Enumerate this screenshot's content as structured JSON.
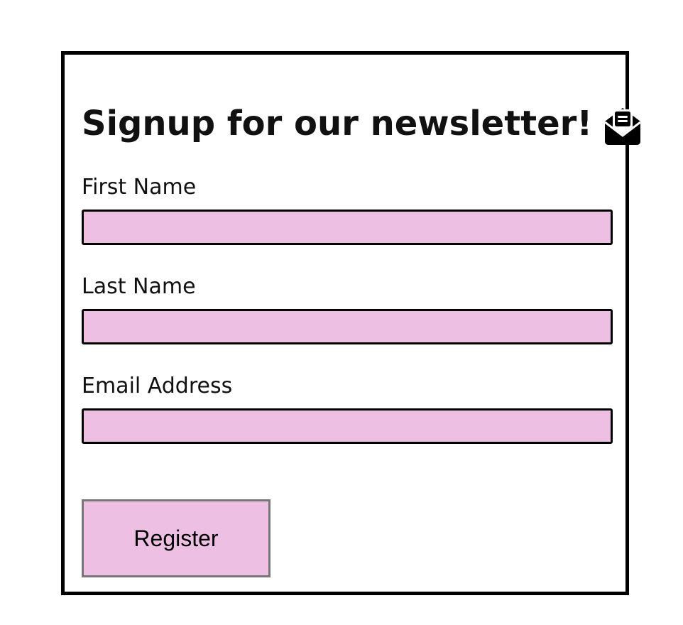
{
  "form": {
    "title": "Signup for our newsletter!",
    "title_icon": "open-envelope-icon",
    "fields": [
      {
        "label": "First Name",
        "value": "",
        "placeholder": ""
      },
      {
        "label": "Last Name",
        "value": "",
        "placeholder": ""
      },
      {
        "label": "Email Address",
        "value": "",
        "placeholder": ""
      }
    ],
    "submit_label": "Register"
  },
  "colors": {
    "input_fill": "#edbfe3",
    "button_fill": "#edbfe3",
    "card_border": "#000000",
    "button_border": "#767676"
  }
}
